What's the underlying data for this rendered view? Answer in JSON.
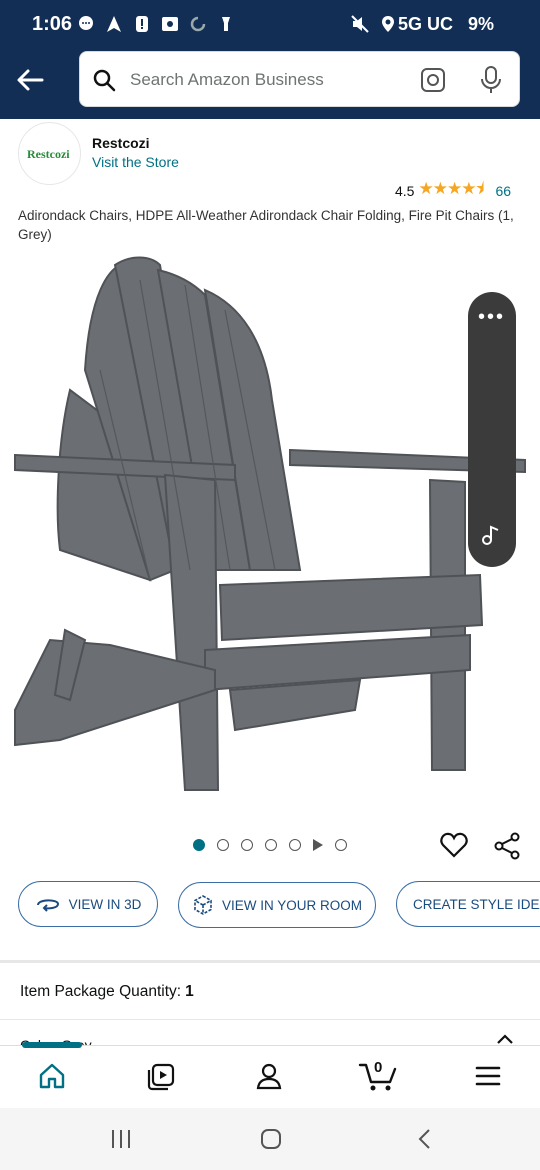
{
  "status_bar": {
    "time": "1:06",
    "carrier": "5G UC",
    "battery": "9%"
  },
  "header": {
    "search_placeholder": "Search Amazon Business"
  },
  "brand": {
    "logo_text": "Restcozi",
    "name": "Restcozi",
    "store_link": "Visit the Store"
  },
  "rating": {
    "value": "4.5",
    "stars": 4.5,
    "count": "66"
  },
  "product": {
    "title": "Adirondack Chairs, HDPE All-Weather Adirondack Chair Folding, Fire Pit Chairs (1, Grey)"
  },
  "gallery": {
    "total_dots": 7,
    "active_index": 0
  },
  "actions": {
    "view_3d": "VIEW IN 3D",
    "view_room": "VIEW IN YOUR ROOM",
    "style_ideas": "CREATE STYLE IDEAS"
  },
  "details": {
    "qty_label": "Item Package Quantity:",
    "qty_value": "1",
    "color_label": "Color: Grey"
  },
  "cart": {
    "count": "0"
  },
  "colors": {
    "header_bg": "#132e55",
    "accent": "#007185",
    "chair_gray": "#6b6e72"
  }
}
